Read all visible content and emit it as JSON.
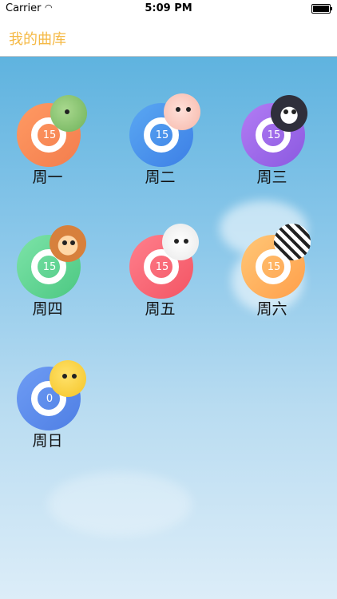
{
  "status_bar": {
    "carrier": "Carrier",
    "time": "5:09 PM"
  },
  "nav": {
    "title": "我的曲库"
  },
  "colors": {
    "title": "#f5b945"
  },
  "days": [
    {
      "label": "周一",
      "count": "15",
      "animal": "duck-icon"
    },
    {
      "label": "周二",
      "count": "15",
      "animal": "pig-icon"
    },
    {
      "label": "周三",
      "count": "15",
      "animal": "penguin-icon"
    },
    {
      "label": "周四",
      "count": "15",
      "animal": "monkey-icon"
    },
    {
      "label": "周五",
      "count": "15",
      "animal": "dog-icon"
    },
    {
      "label": "周六",
      "count": "15",
      "animal": "zebra-icon"
    },
    {
      "label": "周日",
      "count": "0",
      "animal": "chick-icon"
    }
  ]
}
